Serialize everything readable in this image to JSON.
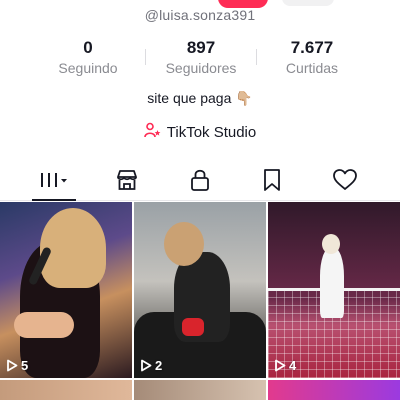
{
  "profile": {
    "handle": "@luisa.sonza391",
    "stats": [
      {
        "value": "0",
        "label": "Seguindo"
      },
      {
        "value": "897",
        "label": "Seguidores"
      },
      {
        "value": "7.677",
        "label": "Curtidas"
      }
    ],
    "bio": "site que paga",
    "bio_emoji": "👇🏼",
    "studio_label": "TikTok Studio"
  },
  "tabs": [
    {
      "name": "videos",
      "icon": "grid-icon",
      "active": true
    },
    {
      "name": "shop",
      "icon": "shop-icon",
      "active": false
    },
    {
      "name": "private",
      "icon": "lock-icon",
      "active": false
    },
    {
      "name": "saved",
      "icon": "bookmark-icon",
      "active": false
    },
    {
      "name": "liked",
      "icon": "heart-icon",
      "active": false
    }
  ],
  "videos": [
    {
      "views": "5"
    },
    {
      "views": "2"
    },
    {
      "views": "4"
    }
  ],
  "colors": {
    "accent": "#fe2c55",
    "text": "#161823",
    "muted": "#8a8b91"
  }
}
